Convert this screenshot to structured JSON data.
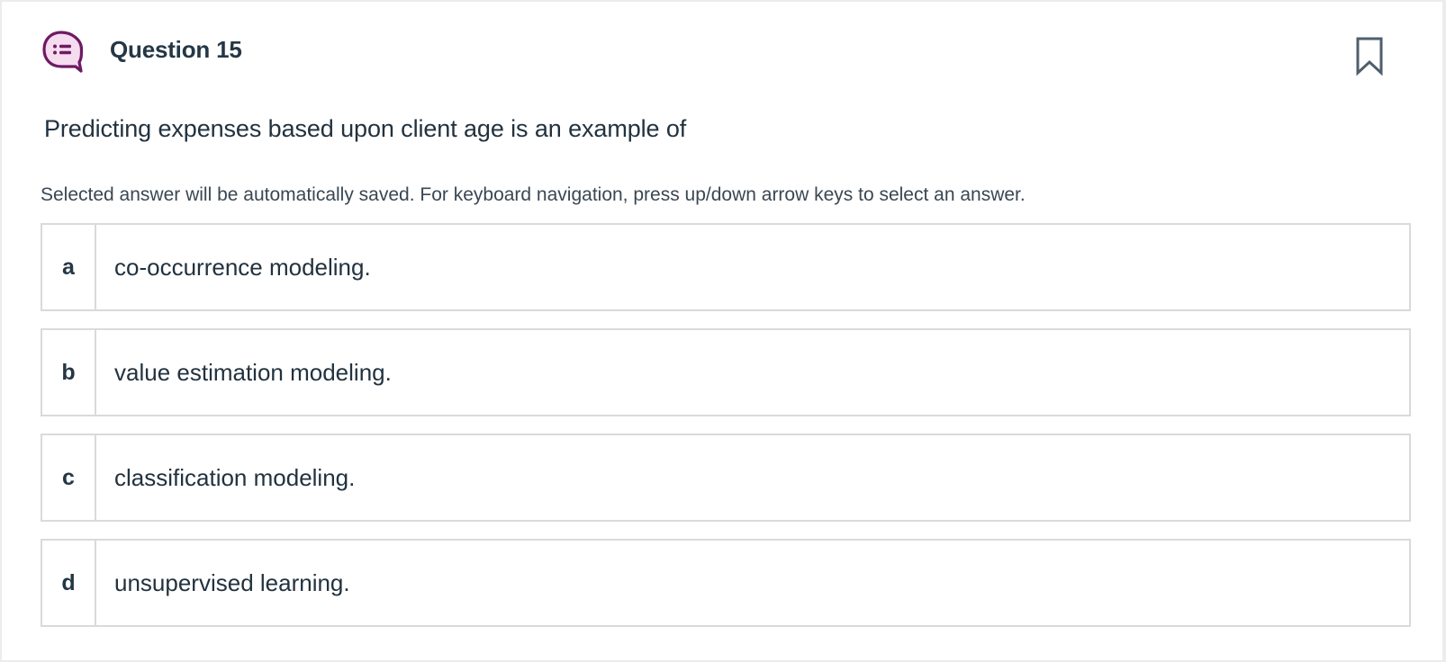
{
  "question": {
    "title": "Question 15",
    "icon": "question-chat-icon",
    "bookmark_icon": "bookmark-icon",
    "prompt": "Predicting expenses based upon client age is an example of",
    "instructions": "Selected answer will be automatically saved. For keyboard navigation, press up/down arrow keys to select an answer."
  },
  "options": [
    {
      "letter": "a",
      "text": "co-occurrence modeling."
    },
    {
      "letter": "b",
      "text": "value estimation modeling."
    },
    {
      "letter": "c",
      "text": "classification modeling."
    },
    {
      "letter": "d",
      "text": "unsupervised learning."
    }
  ],
  "colors": {
    "icon_purple": "#6e1a63",
    "icon_fill": "#f5dcef",
    "text_dark": "#243746",
    "border": "#d8dadb",
    "bookmark": "#4f5e6b"
  }
}
